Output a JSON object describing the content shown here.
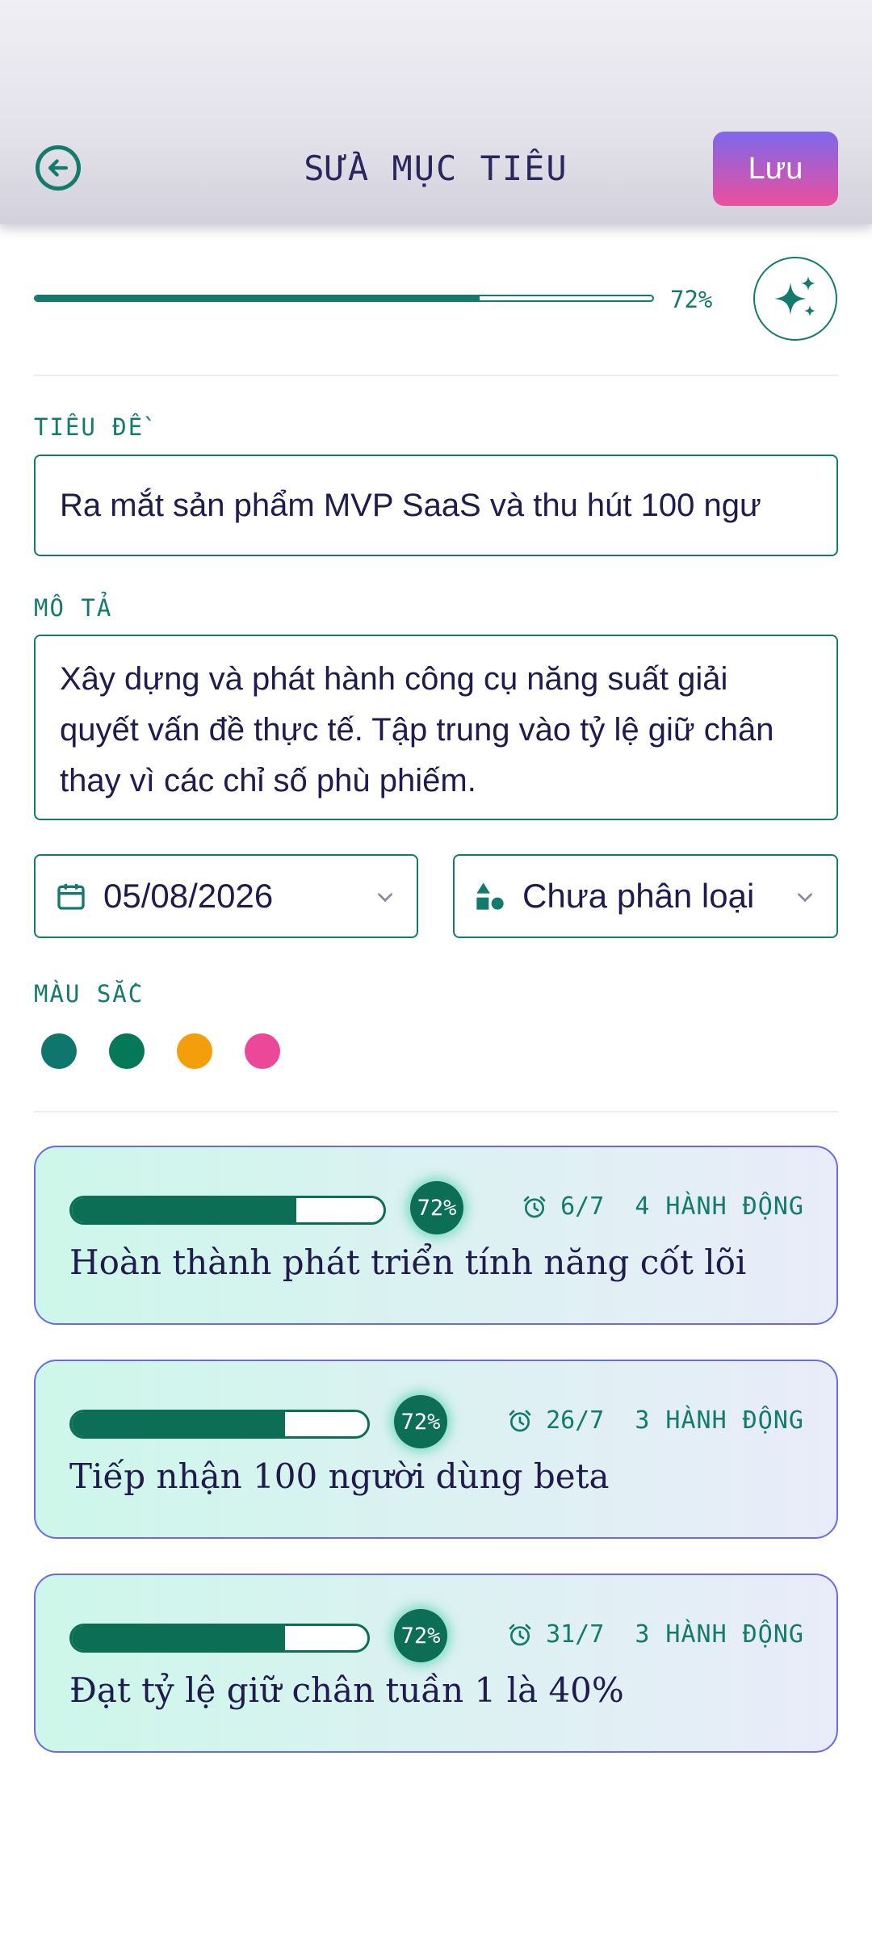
{
  "header": {
    "title": "SỬA MỤC TIÊU",
    "save_label": "Lưu"
  },
  "progress": {
    "value": 0.72,
    "label": "72%"
  },
  "form": {
    "title_label": "TIÊU ĐỀ",
    "title_value": "Ra mắt sản phẩm MVP SaaS và thu hút 100 ngư",
    "description_label": "MÔ TẢ",
    "description_value": "Xây dựng và phát hành công cụ năng suất giải quyết vấn đề thực tế. Tập trung vào tỷ lệ giữ chân thay vì các chỉ số phù phiếm.",
    "date_value": "05/08/2026",
    "category_value": "Chưa phân loại",
    "color_label": "MÀU SẮC",
    "colors": [
      "#0f766e",
      "#047857",
      "#f59e0b",
      "#ec4899"
    ]
  },
  "milestones": [
    {
      "progress": 0.72,
      "percent_label": "72%",
      "date": "6/7",
      "actions": "4 HÀNH ĐỘNG",
      "title": "Hoàn thành phát triển tính năng cốt lõi"
    },
    {
      "progress": 0.72,
      "percent_label": "72%",
      "date": "26/7",
      "actions": "3 HÀNH ĐỘNG",
      "title": "Tiếp nhận 100 người dùng beta"
    },
    {
      "progress": 0.72,
      "percent_label": "72%",
      "date": "31/7",
      "actions": "3 HÀNH ĐỘNG",
      "title": "Đạt tỷ lệ giữ chân tuần 1 là 40%"
    }
  ]
}
